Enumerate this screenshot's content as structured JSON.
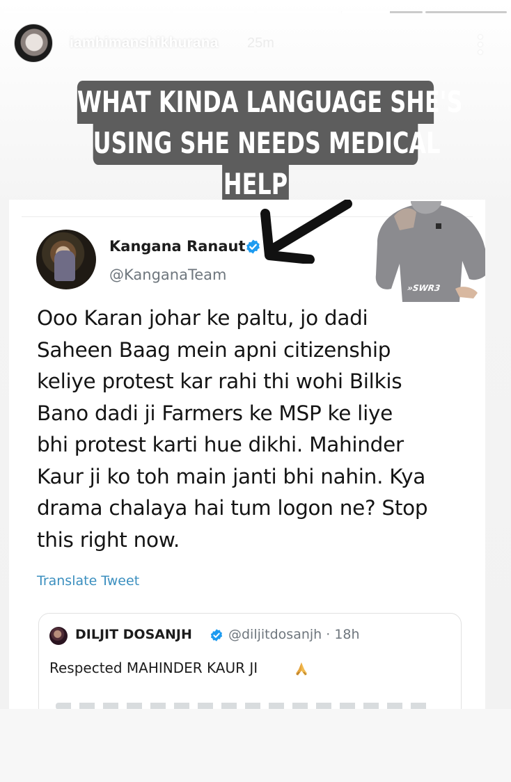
{
  "story": {
    "progress": [
      1,
      1,
      1,
      1,
      0.6,
      0
    ],
    "username": "iamhimanshikhurana",
    "time_ago": "25m",
    "caption_lines": [
      "WHAT KINDA LANGUAGE SHE'S",
      "USING SHE NEEDS MEDICAL",
      "HELP"
    ]
  },
  "tweet": {
    "display_name": "Kangana Ranaut",
    "handle": "@KanganaTeam",
    "body": "Ooo Karan johar ke paltu, jo dadi\nSaheen Baag mein apni citizenship\nkeliye protest kar rahi thi wohi Bilkis\nBano dadi ji Farmers ke MSP ke liye\nbhi protest karti hue dikhi. Mahinder\nKaur ji ko toh main janti bhi nahin. Kya\ndrama chalaya hai tum logon ne? Stop\nthis right now.",
    "translate_label": "Translate Tweet",
    "sticker_label": "»SWR3"
  },
  "quote": {
    "name": "DILJIT DOSANJH",
    "handle_time": "@diljitdosanjh · 18h",
    "text": "Respected MAHINDER KAUR JI"
  },
  "colors": {
    "caption_bg": "#5d5d5d",
    "verified": "#1d9bf0",
    "link": "#3b8fbf"
  },
  "icons": [
    "more-vertical-icon",
    "verified-badge-icon",
    "arrow-pointer-icon",
    "folded-hands-icon"
  ]
}
